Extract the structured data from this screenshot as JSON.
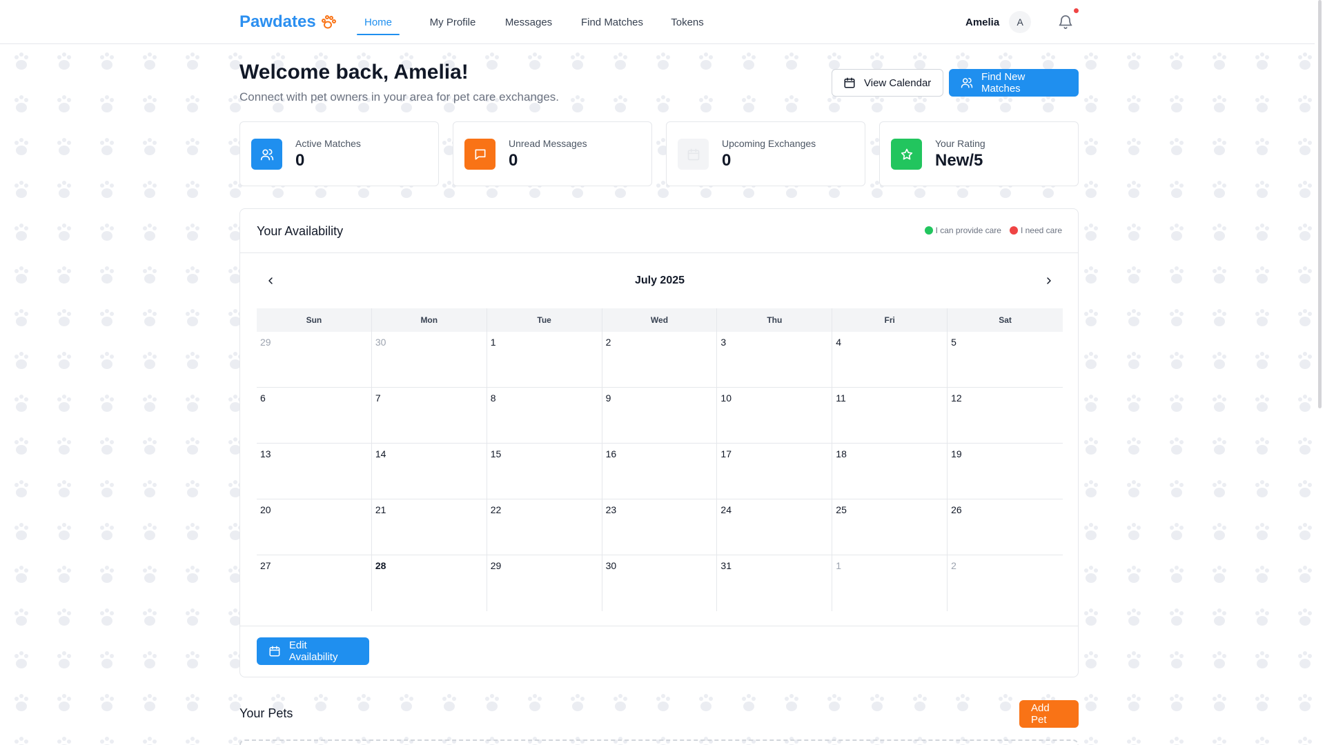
{
  "nav": {
    "brand": "Pawdates",
    "links": [
      {
        "label": "Home",
        "active": true
      },
      {
        "label": "My Profile",
        "active": false
      },
      {
        "label": "Messages",
        "active": false
      },
      {
        "label": "Find Matches",
        "active": false
      },
      {
        "label": "Tokens",
        "active": false
      }
    ],
    "user_name": "Amelia",
    "avatar_initial": "A",
    "notification_dot_color": "#ef4444"
  },
  "header": {
    "welcome": "Welcome back, Amelia!",
    "subtitle": "Connect with pet owners in your area for pet care exchanges.",
    "view_calendar_label": "View Calendar",
    "find_matches_label": "Find New Matches"
  },
  "stats": [
    {
      "label": "Active Matches",
      "value": "0",
      "icon": "users-icon",
      "color": "#1f8fef"
    },
    {
      "label": "Unread Messages",
      "value": "0",
      "icon": "message-icon",
      "color": "#f97316"
    },
    {
      "label": "Upcoming Exchanges",
      "value": "0",
      "icon": "calendar-icon",
      "color": "#f3f4f6"
    },
    {
      "label": "Your Rating",
      "value": "New/5",
      "icon": "star-icon",
      "color": "#22c55e"
    }
  ],
  "availability": {
    "title": "Your Availability",
    "legend": [
      {
        "label": "I can provide care",
        "color": "#22c55e"
      },
      {
        "label": "I need care",
        "color": "#ef4444"
      }
    ],
    "month": "July 2025",
    "weekdays": [
      "Sun",
      "Mon",
      "Tue",
      "Wed",
      "Thu",
      "Fri",
      "Sat"
    ],
    "days": [
      {
        "d": "29",
        "muted": true
      },
      {
        "d": "30",
        "muted": true
      },
      {
        "d": "1"
      },
      {
        "d": "2"
      },
      {
        "d": "3"
      },
      {
        "d": "4"
      },
      {
        "d": "5"
      },
      {
        "d": "6"
      },
      {
        "d": "7"
      },
      {
        "d": "8"
      },
      {
        "d": "9"
      },
      {
        "d": "10"
      },
      {
        "d": "11"
      },
      {
        "d": "12"
      },
      {
        "d": "13"
      },
      {
        "d": "14"
      },
      {
        "d": "15"
      },
      {
        "d": "16"
      },
      {
        "d": "17"
      },
      {
        "d": "18"
      },
      {
        "d": "19"
      },
      {
        "d": "20"
      },
      {
        "d": "21"
      },
      {
        "d": "22"
      },
      {
        "d": "23"
      },
      {
        "d": "24"
      },
      {
        "d": "25"
      },
      {
        "d": "26"
      },
      {
        "d": "27"
      },
      {
        "d": "28",
        "today": true
      },
      {
        "d": "29"
      },
      {
        "d": "30"
      },
      {
        "d": "31"
      },
      {
        "d": "1",
        "muted": true
      },
      {
        "d": "2",
        "muted": true
      }
    ],
    "edit_label": "Edit Availability"
  },
  "pets": {
    "title": "Your Pets",
    "add_label": "Add Pet"
  }
}
